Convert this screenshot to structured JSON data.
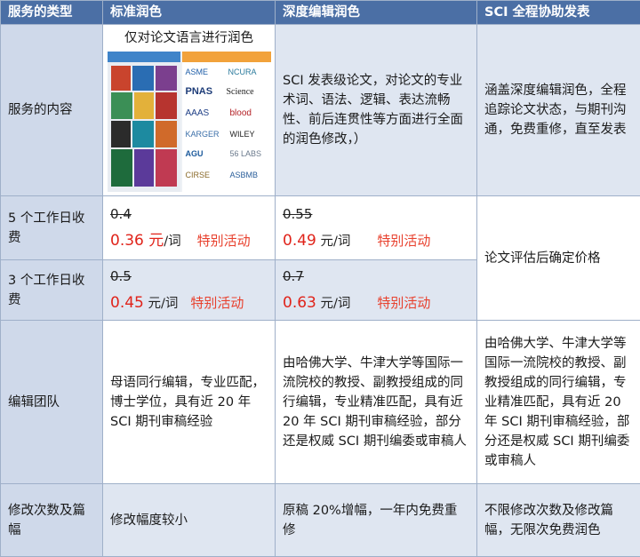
{
  "header": {
    "col0": "服务的类型",
    "col1": "标准润色",
    "col2": "深度编辑润色",
    "col3": "SCI 全程协助发表"
  },
  "rows": {
    "content": {
      "label": "服务的内容",
      "standard_title": "仅对论文语言进行润色",
      "deep": "SCI 发表级论文，对论文的专业术词、语法、逻辑、表达流畅性、前后连贯性等方面进行全面的润色修改，）",
      "full": "涵盖深度编辑润色，全程追踪论文状态，与期刊沟通，免费重修，直至发表"
    },
    "five_day": {
      "label": "5 个工作日收费",
      "standard_old": "0.4",
      "standard_new": "0.36 元",
      "standard_unit": "/词",
      "standard_promo": "特别活动",
      "deep_old": "0.55",
      "deep_new": "0.49",
      "deep_unit": "元/词",
      "deep_promo": "特别活动"
    },
    "three_day": {
      "label": "3 个工作日收费",
      "standard_old": "0.5",
      "standard_new": "0.45",
      "standard_unit": "元/词",
      "standard_promo": "特别活动",
      "deep_old": "0.7",
      "deep_new": "0.63",
      "deep_unit": "元/词",
      "deep_promo": "特别活动"
    },
    "pricing_full": "论文评估后确定价格",
    "team": {
      "label": "编辑团队",
      "standard": "母语同行编辑，专业匹配，博士学位，具有近 20 年 SCI 期刊审稿经验",
      "deep": "由哈佛大学、牛津大学等国际一流院校的教授、副教授组成的同行编辑，专业精准匹配，具有近 20 年 SCI 期刊审稿经验，部分还是权威 SCI 期刊编委或审稿人",
      "full": "由哈佛大学、牛津大学等国际一流院校的教授、副教授组成的同行编辑，专业精准匹配，具有近 20 年 SCI 期刊审稿经验，部分还是权威 SCI 期刊编委或审稿人"
    },
    "revision": {
      "label": "修改次数及篇幅",
      "standard": "修改幅度较小",
      "deep": "原稿 20%增幅，一年内免费重修",
      "full": "不限修改次数及修改篇幅，无限次免费润色"
    }
  },
  "collage": {
    "logos": [
      "ASME",
      "NCURA",
      "PNAS",
      "Science",
      "AAAS",
      "blood",
      "KARGER",
      "WILEY",
      "AGU",
      "56 LABS",
      "CIRSE",
      "ASBMB"
    ]
  },
  "colors": {
    "header_bg": "#4b6fa5",
    "row_tint": "#dfe6f1",
    "price_red": "#e0231a",
    "promo_red": "#e8412e"
  }
}
